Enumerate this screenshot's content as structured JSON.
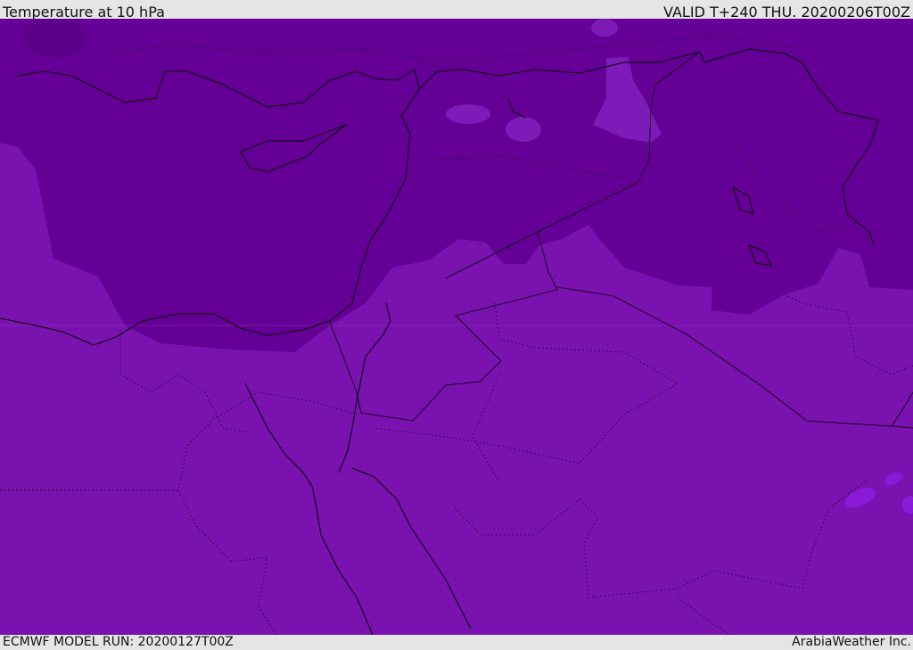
{
  "header": {
    "title": "Temperature at 10 hPa",
    "valid": "VALID T+240 THU. 20200206T00Z"
  },
  "footer": {
    "model_run": "ECMWF MODEL RUN: 20200127T00Z",
    "credit": "ArabiaWeather Inc."
  },
  "colors": {
    "dark_band": "#650096",
    "light_band": "#7a12b0",
    "lighter_blob": "#7c1bb8",
    "warm_spot": "#8a1ad8",
    "background": "#e5e5e5"
  }
}
